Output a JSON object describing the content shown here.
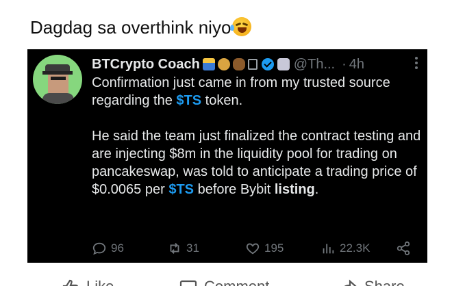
{
  "caption": {
    "text": "Dagdag sa overthink niyo",
    "emoji": "rolling-on-floor-laughing-emoji"
  },
  "tweet": {
    "author": {
      "name": "BTCrypto Coach",
      "badges": [
        "bar-chart-badge",
        "money-bag-badge",
        "bear-badge",
        "link-badge"
      ],
      "handle": "@Th...",
      "dot": "·",
      "time": "4h"
    },
    "body": {
      "p1_a": "Confirmation just came in from my trusted source regarding the ",
      "p1_cashtag": "$TS",
      "p1_b": " token.",
      "p2_a": "He said the team just finalized the contract testing and are injecting $8m in the liquidity pool for trading on pancakeswap, was told to anticipate a trading price of $0.0065 per ",
      "p2_cashtag": "$TS",
      "p2_b": " before Bybit ",
      "p2_bold": "listing",
      "p2_c": "."
    },
    "actions": {
      "replies": "96",
      "reposts": "31",
      "likes": "195",
      "views": "22.3K"
    },
    "colors": {
      "accent": "#1d9bf0",
      "muted": "#71767b",
      "background": "#000000"
    }
  },
  "footer": {
    "like": "Like",
    "comment": "Comment",
    "share": "Share"
  }
}
